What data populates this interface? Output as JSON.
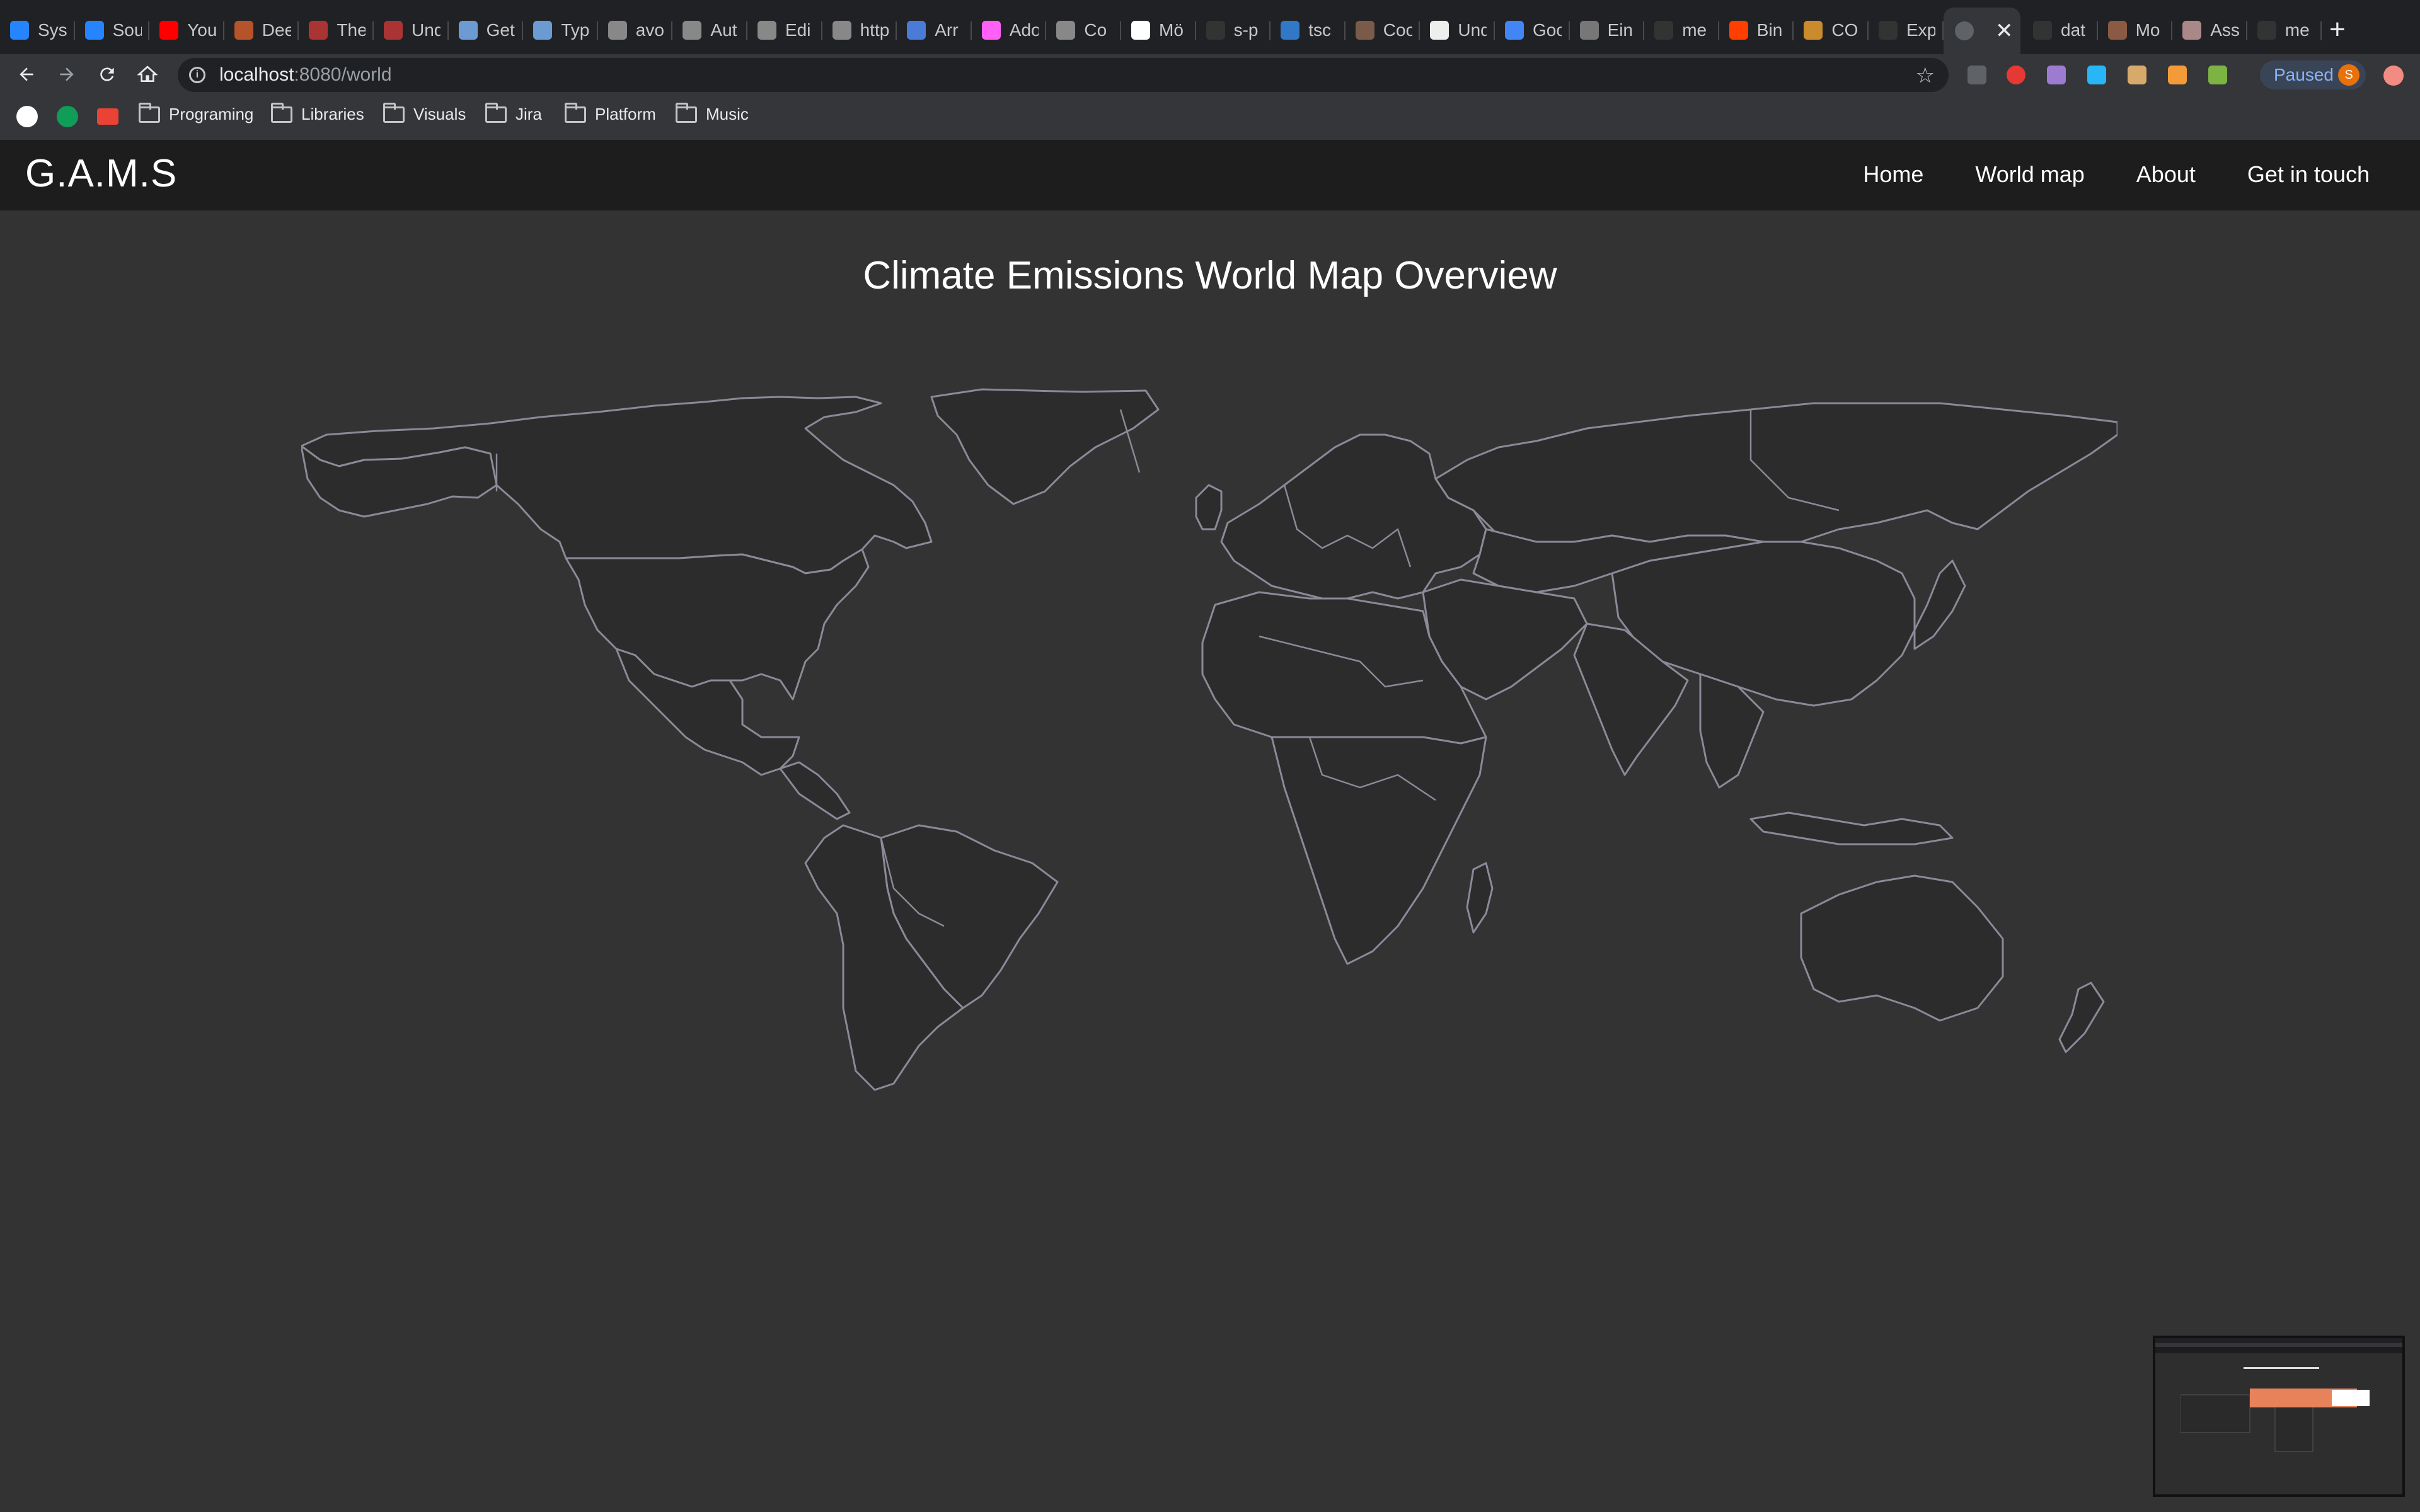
{
  "browser": {
    "tabs": [
      {
        "title": "Sys",
        "icon": "jira-icon",
        "color": "#2684ff"
      },
      {
        "title": "Sou",
        "icon": "bitbucket-icon",
        "color": "#2684ff"
      },
      {
        "title": "You",
        "icon": "youtube-icon",
        "color": "#ff0000"
      },
      {
        "title": "Dee",
        "icon": "image-icon",
        "color": "#b5542a"
      },
      {
        "title": "The",
        "icon": "udemy-icon",
        "color": "#a33"
      },
      {
        "title": "Und",
        "icon": "udemy-icon",
        "color": "#a33"
      },
      {
        "title": "Get",
        "icon": "webpack-icon",
        "color": "#6b9bd2"
      },
      {
        "title": "Typ",
        "icon": "webpack-icon",
        "color": "#6b9bd2"
      },
      {
        "title": "avo",
        "icon": "list-icon",
        "color": "#888"
      },
      {
        "title": "Aut",
        "icon": "puzzle-icon",
        "color": "#888"
      },
      {
        "title": "Edi",
        "icon": "puzzle-icon",
        "color": "#888"
      },
      {
        "title": "http",
        "icon": "puzzle-icon",
        "color": "#888"
      },
      {
        "title": "Arr",
        "icon": "flag-icon",
        "color": "#4a7bd6"
      },
      {
        "title": "Ado",
        "icon": "xd-icon",
        "color": "#ff61f6"
      },
      {
        "title": "Co",
        "icon": "codepen-icon",
        "color": "#888"
      },
      {
        "title": "Mö",
        "icon": "codepen-icon",
        "color": "#fff"
      },
      {
        "title": "s-p",
        "icon": "github-icon",
        "color": "#333"
      },
      {
        "title": "tsc",
        "icon": "typescript-icon",
        "color": "#3178c6"
      },
      {
        "title": "Coo",
        "icon": "avatar-icon",
        "color": "#7a5b4a"
      },
      {
        "title": "Und",
        "icon": "medium-icon",
        "color": "#eee"
      },
      {
        "title": "Goo",
        "icon": "docs-icon",
        "color": "#4285f4"
      },
      {
        "title": "Ein",
        "icon": "avatar-icon",
        "color": "#777"
      },
      {
        "title": "me",
        "icon": "github-icon",
        "color": "#333"
      },
      {
        "title": "Bin",
        "icon": "svelte-icon",
        "color": "#ff3e00"
      },
      {
        "title": "CO",
        "icon": "circle-icon",
        "color": "#c98b2c"
      },
      {
        "title": "Exp",
        "icon": "github-icon",
        "color": "#333"
      }
    ],
    "active_tab_close": "✕",
    "tabs_after": [
      {
        "title": "dat",
        "icon": "github-icon",
        "color": "#333"
      },
      {
        "title": "Mo",
        "icon": "acorn-icon",
        "color": "#8a5a44"
      },
      {
        "title": "Ass",
        "icon": "box-icon",
        "color": "#a88"
      },
      {
        "title": "me",
        "icon": "github-icon",
        "color": "#333"
      }
    ],
    "new_tab": "+",
    "url_host": "localhost",
    "url_path": ":8080/world",
    "profile_status": "Paused",
    "profile_initial": "S",
    "bookmarks": [
      {
        "label": "Programing"
      },
      {
        "label": "Libraries"
      },
      {
        "label": "Visuals"
      },
      {
        "label": "Jira"
      },
      {
        "label": "Platform"
      },
      {
        "label": "Music"
      }
    ]
  },
  "site": {
    "brand": "G.A.M.S",
    "nav": [
      "Home",
      "World map",
      "About",
      "Get in touch"
    ],
    "page_title": "Climate Emissions World Map Overview"
  },
  "colors": {
    "page_bg": "#333333",
    "nav_bg": "#1d1d1d",
    "map_fill": "#2c2c2c",
    "map_stroke": "#8a8a98",
    "preview_highlight": "#e8825a"
  }
}
